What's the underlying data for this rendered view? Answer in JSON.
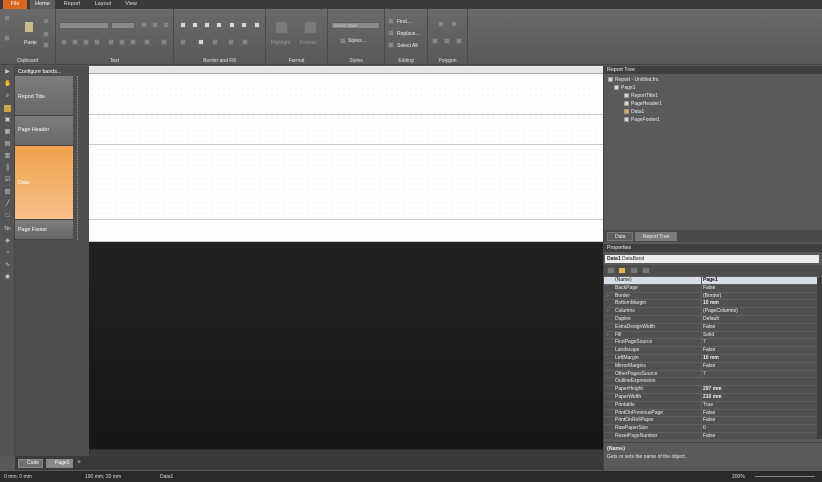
{
  "menu": {
    "file": "File",
    "tabs": [
      "Home",
      "Report",
      "Layout",
      "View"
    ],
    "active": "Home"
  },
  "ribbon": {
    "clipboard": {
      "paste": "Paste",
      "label": "Clipboard"
    },
    "text": {
      "label": "Text"
    },
    "border_fill": {
      "label": "Border and Fill"
    },
    "format": {
      "highlight": "Highlight",
      "format": "Format",
      "label": "Format"
    },
    "styles": {
      "select_placeholder": "Select style",
      "styles_btn": "Styles...",
      "label": "Styles"
    },
    "editing": {
      "find": "Find...",
      "replace": "Replace...",
      "select_all": "Select All",
      "label": "Editing"
    },
    "polygon": {
      "label": "Polygon"
    }
  },
  "left_tools": [
    "pointer-icon",
    "hand-icon",
    "zoom-icon",
    "text-icon",
    "picture-icon",
    "table-icon",
    "matrix-icon",
    "chart-icon",
    "barcode-icon",
    "checkbox-icon",
    "richtext-icon",
    "line-icon",
    "shape-icon",
    "number-icon",
    "map-icon",
    "gauge-icon",
    "sparkline-icon",
    "zip-icon"
  ],
  "bands": {
    "configure": "Configure bands...",
    "items": [
      "Report Title",
      "Page Header",
      "Data",
      "Page Footer"
    ]
  },
  "bottom_tabs": [
    "Code",
    "Page1"
  ],
  "status": {
    "position": "0 mm; 0 mm",
    "size": "190 mm; 20 mm",
    "object": "Data1",
    "zoom": "200%"
  },
  "report_tree": {
    "title": "Report Tree",
    "root": "Report - Untitled.frx",
    "page": "Page1",
    "children": [
      "ReportTitle1",
      "PageHeader1",
      "Data1",
      "PageFooter1"
    ],
    "tabs": [
      "Data",
      "Report Tree"
    ]
  },
  "properties": {
    "title": "Properties",
    "object_name": "Data1",
    "object_type": "DataBand",
    "rows": [
      {
        "name": "(Name)",
        "value": "Page1",
        "bold": true,
        "expand": false
      },
      {
        "name": "BackPage",
        "value": "False",
        "bold": false,
        "expand": false
      },
      {
        "name": "Border",
        "value": "(Border)",
        "bold": false,
        "expand": true
      },
      {
        "name": "BottomMargin",
        "value": "10 mm",
        "bold": true,
        "expand": false
      },
      {
        "name": "Columns",
        "value": "(PageColumns)",
        "bold": false,
        "expand": true
      },
      {
        "name": "Duplex",
        "value": "Default",
        "bold": false,
        "expand": false
      },
      {
        "name": "ExtraDesignWidth",
        "value": "False",
        "bold": false,
        "expand": false
      },
      {
        "name": "Fill",
        "value": "Solid",
        "bold": false,
        "expand": true
      },
      {
        "name": "FirstPageSource",
        "value": "7",
        "bold": false,
        "expand": false
      },
      {
        "name": "Landscape",
        "value": "False",
        "bold": false,
        "expand": false
      },
      {
        "name": "LeftMargin",
        "value": "10 mm",
        "bold": true,
        "expand": false
      },
      {
        "name": "MirrorMargins",
        "value": "False",
        "bold": false,
        "expand": false
      },
      {
        "name": "OtherPagesSource",
        "value": "7",
        "bold": false,
        "expand": false
      },
      {
        "name": "OutlineExpression",
        "value": "",
        "bold": false,
        "expand": false
      },
      {
        "name": "PaperHeight",
        "value": "297 mm",
        "bold": true,
        "expand": false
      },
      {
        "name": "PaperWidth",
        "value": "210 mm",
        "bold": true,
        "expand": false
      },
      {
        "name": "Printable",
        "value": "True",
        "bold": false,
        "expand": false
      },
      {
        "name": "PrintOnPreviousPage",
        "value": "False",
        "bold": false,
        "expand": false
      },
      {
        "name": "PrintOnRollPaper",
        "value": "False",
        "bold": false,
        "expand": false
      },
      {
        "name": "RawPaperSize",
        "value": "0",
        "bold": false,
        "expand": false
      },
      {
        "name": "ResetPageNumber",
        "value": "False",
        "bold": false,
        "expand": false
      }
    ],
    "desc_title": "(Name)",
    "desc_text": "Gets or sets the name of the object."
  }
}
